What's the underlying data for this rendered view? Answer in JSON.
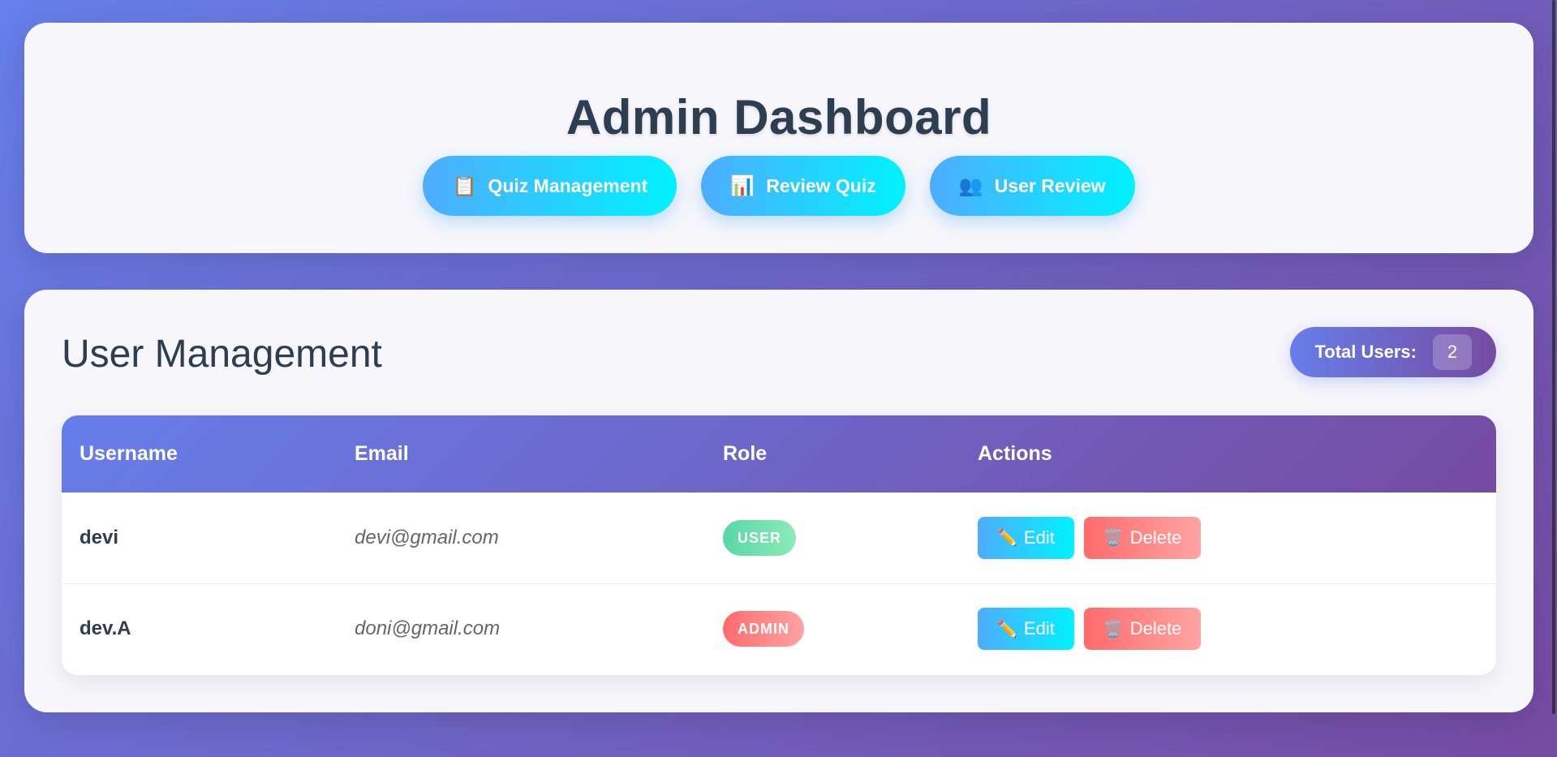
{
  "header": {
    "title": "Admin Dashboard",
    "nav": [
      {
        "label": "Quiz Management",
        "icon": "📋",
        "icon_name": "clipboard-icon"
      },
      {
        "label": "Review Quiz",
        "icon": "📊",
        "icon_name": "bar-chart-icon"
      },
      {
        "label": "User Review",
        "icon": "👥",
        "icon_name": "users-icon"
      }
    ]
  },
  "users_section": {
    "title": "User Management",
    "total_label": "Total Users:",
    "total_value": "2",
    "columns": [
      "Username",
      "Email",
      "Role",
      "Actions"
    ],
    "rows": [
      {
        "username": "devi",
        "email": "devi@gmail.com",
        "role": "USER"
      },
      {
        "username": "dev.A",
        "email": "doni@gmail.com",
        "role": "ADMIN"
      }
    ],
    "edit_label": "Edit",
    "delete_label": "Delete",
    "edit_icon": "✏️",
    "delete_icon": "🗑️"
  },
  "colors": {
    "background_start": "#667eea",
    "background_end": "#764ba2",
    "button_cyan_start": "#4facfe",
    "button_cyan_end": "#00f2fe",
    "danger": "#ff6b6b",
    "success": "#56d8a8",
    "title_text": "#2c3e50"
  }
}
